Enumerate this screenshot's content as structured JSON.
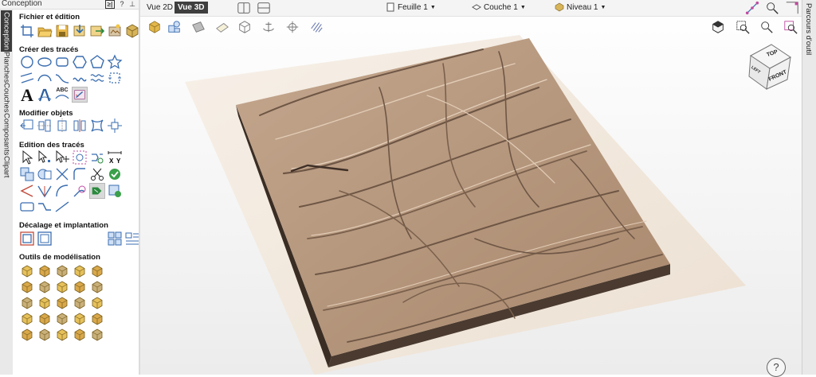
{
  "panel": {
    "title": "Conception",
    "header_buttons": {
      "pin_box": "≥|",
      "help": "?",
      "pin": "⊥"
    },
    "sections": [
      {
        "title": "Fichier et édition"
      },
      {
        "title": "Créer des tracés"
      },
      {
        "title": "Modifier objets"
      },
      {
        "title": "Edition des tracés"
      },
      {
        "title": "Décalage et implantation"
      },
      {
        "title": "Outils de modélisation"
      }
    ],
    "text_tool_letter": "A",
    "abc_label": "ABC"
  },
  "vertical_tabs": [
    "Conception",
    "Planches",
    "Couches",
    "Composants",
    "Clipart"
  ],
  "view_tabs": [
    "Vue 2D",
    "Vue 3D"
  ],
  "active_view_tab": "Vue 3D",
  "dropdowns": {
    "sheet": "Feuille 1",
    "layer": "Couche 1",
    "level": "Niveau 1"
  },
  "view_cube": {
    "top": "TOP",
    "front": "FRONT",
    "left": "LEFT"
  },
  "right_strip_label": "Parcours d'outil",
  "help_label": "?",
  "colors": {
    "accent_dark": "#3b3b3b",
    "relief": "#b89a82",
    "relief_shadow": "#6e5645",
    "plinth": "#efe6dc",
    "base_edge": "#3a2d24"
  }
}
